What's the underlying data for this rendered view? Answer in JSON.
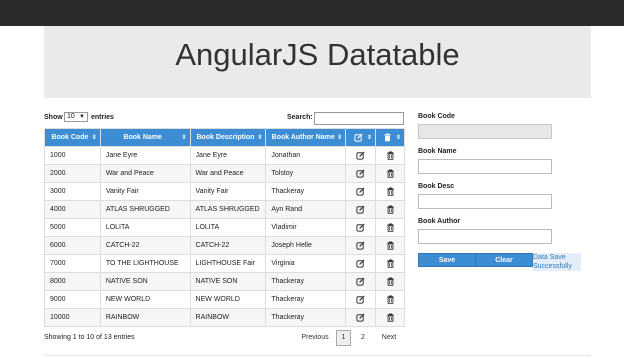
{
  "header": {
    "title": "AngularJS Datatable"
  },
  "table_controls": {
    "show_label": "Show",
    "page_size": "10",
    "entries_label": "entries",
    "search_label": "Search:",
    "search_value": ""
  },
  "table": {
    "columns": [
      "Book Code",
      "Book Name",
      "Book Description",
      "Book Author Name"
    ],
    "edit_column_icon": "edit-icon",
    "delete_column_icon": "trash-icon",
    "header_color": "#3c8dd4",
    "rows": [
      {
        "code": "1000",
        "name": "Jane Eyre",
        "desc": "Jane Eyre",
        "author": "Jonathan"
      },
      {
        "code": "2000",
        "name": "War and Peace",
        "desc": "War and Peace",
        "author": "Tolstoy"
      },
      {
        "code": "3000",
        "name": "Vanity Fair",
        "desc": "Vanity Fair",
        "author": "Thackeray"
      },
      {
        "code": "4000",
        "name": "ATLAS SHRUGGED",
        "desc": "ATLAS SHRUGGED",
        "author": "Ayn Rand"
      },
      {
        "code": "5000",
        "name": "LOLITA",
        "desc": "LOLITA",
        "author": "Vladimir"
      },
      {
        "code": "6000",
        "name": "CATCH-22",
        "desc": "CATCH-22",
        "author": "Joseph Helle"
      },
      {
        "code": "7000",
        "name": "TO THE LIGHTHOUSE",
        "desc": "LIGHTHOUSE Fair",
        "author": "Virginia"
      },
      {
        "code": "8000",
        "name": "NATIVE SON",
        "desc": "NATIVE SON",
        "author": "Thackeray"
      },
      {
        "code": "9000",
        "name": "NEW WORLD",
        "desc": "NEW WORLD",
        "author": "Thackeray"
      },
      {
        "code": "10000",
        "name": "RAINBOW",
        "desc": "RAINBOW",
        "author": "Thackeray"
      }
    ]
  },
  "footer": {
    "info": "Showing 1 to 10 of 13 entries",
    "previous": "Previous",
    "page1": "1",
    "page2": "2",
    "next": "Next"
  },
  "form": {
    "code_label": "Book Code",
    "code_value": "",
    "name_label": "Book Name",
    "name_value": "",
    "desc_label": "Book Desc",
    "desc_value": "",
    "author_label": "Book Author",
    "author_value": "",
    "save_label": "Save",
    "clear_label": "Clear",
    "status_text": "Data Save Successfully"
  }
}
